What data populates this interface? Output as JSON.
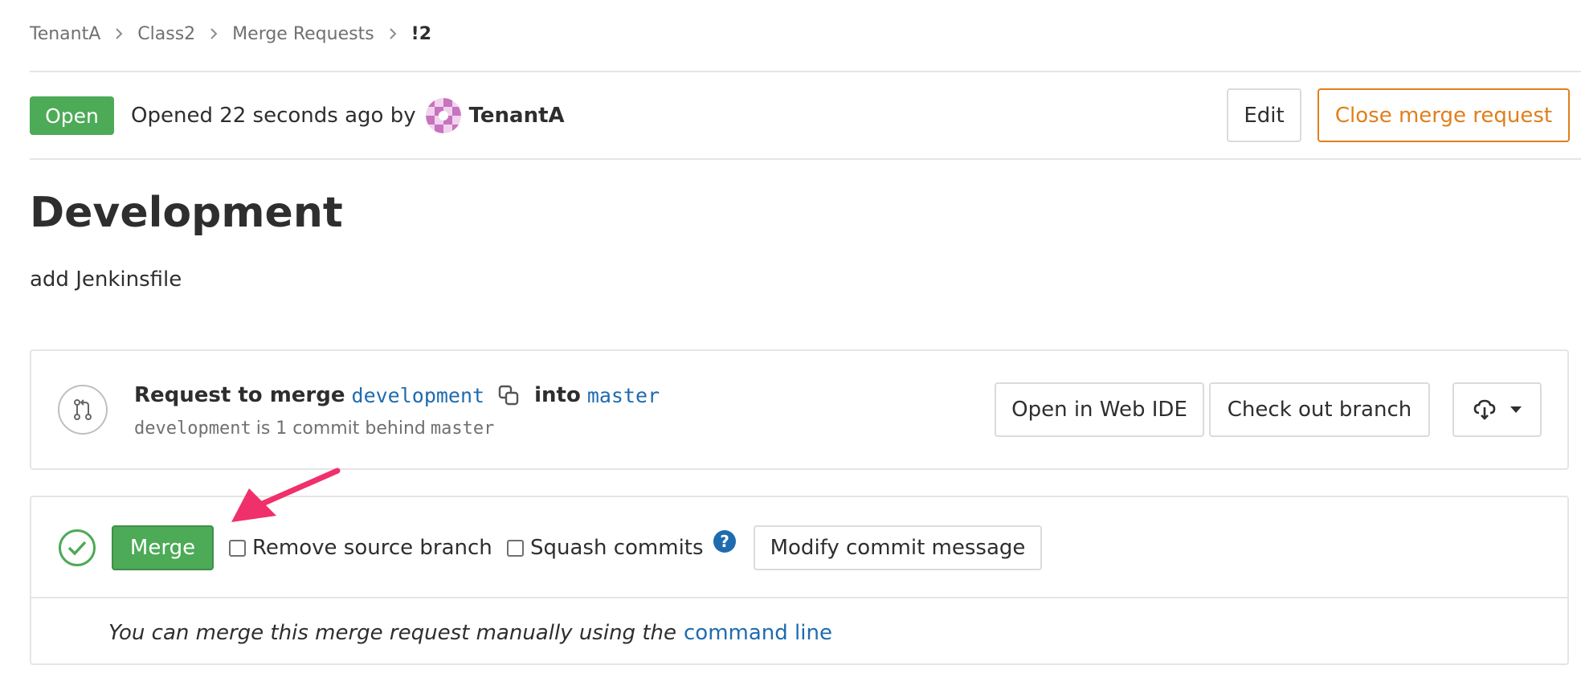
{
  "breadcrumb": {
    "items": [
      "TenantA",
      "Class2",
      "Merge Requests"
    ],
    "current": "!2"
  },
  "header": {
    "status": "Open",
    "opened_text": "Opened 22 seconds ago by",
    "author": "TenantA",
    "edit_label": "Edit",
    "close_label": "Close merge request"
  },
  "mr": {
    "title": "Development",
    "description": "add Jenkinsfile"
  },
  "branch_panel": {
    "request_label": "Request to merge",
    "source_branch": "development",
    "into_label": "into",
    "target_branch": "master",
    "behind_source": "development",
    "behind_text": "is 1 commit behind",
    "behind_target": "master",
    "open_web_ide_label": "Open in Web IDE",
    "checkout_label": "Check out branch"
  },
  "merge_panel": {
    "merge_label": "Merge",
    "remove_source_label": "Remove source branch",
    "squash_label": "Squash commits",
    "modify_commit_label": "Modify commit message",
    "manual_text": "You can merge this merge request manually using the",
    "command_line_link": "command line"
  },
  "colors": {
    "success": "#4daa57",
    "warning": "#e07f1c",
    "link": "#1f6bb0",
    "annotation": "#f0306a"
  },
  "icons": [
    "chevron-right-icon",
    "avatar-identicon",
    "merge-request-icon",
    "copy-icon",
    "download-icon",
    "caret-down-icon",
    "check-circle-icon",
    "question-icon",
    "annotation-arrow"
  ]
}
